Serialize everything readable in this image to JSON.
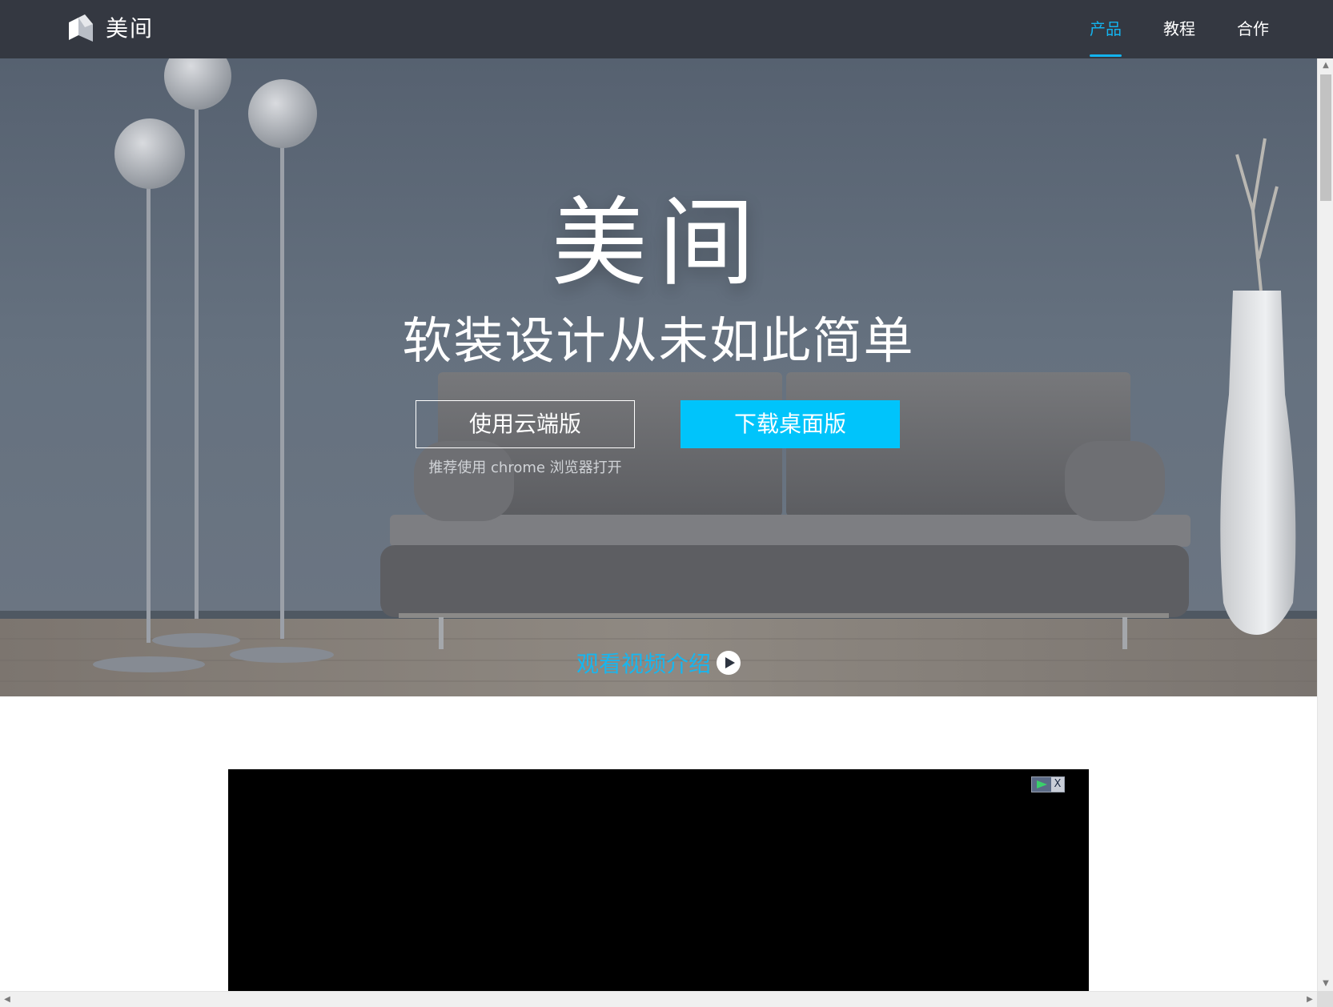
{
  "brand": {
    "name": "美间"
  },
  "nav": {
    "items": [
      {
        "label": "产品",
        "active": true
      },
      {
        "label": "教程",
        "active": false
      },
      {
        "label": "合作",
        "active": false
      }
    ]
  },
  "hero": {
    "title": "美间",
    "subtitle": "软装设计从未如此简单",
    "cloud_button": "使用云端版",
    "download_button": "下载桌面版",
    "hint": "推荐使用 chrome 浏览器打开",
    "video_link": "观看视频介绍"
  },
  "player": {
    "close_glyph": "X"
  },
  "icons": [
    "logo-icon",
    "play-circle-icon",
    "player-play-icon",
    "player-close-icon"
  ],
  "colors": {
    "topbar": "#343841",
    "accent": "#13b3ee",
    "download_button": "#00c4fb",
    "player_bg": "#000000"
  }
}
